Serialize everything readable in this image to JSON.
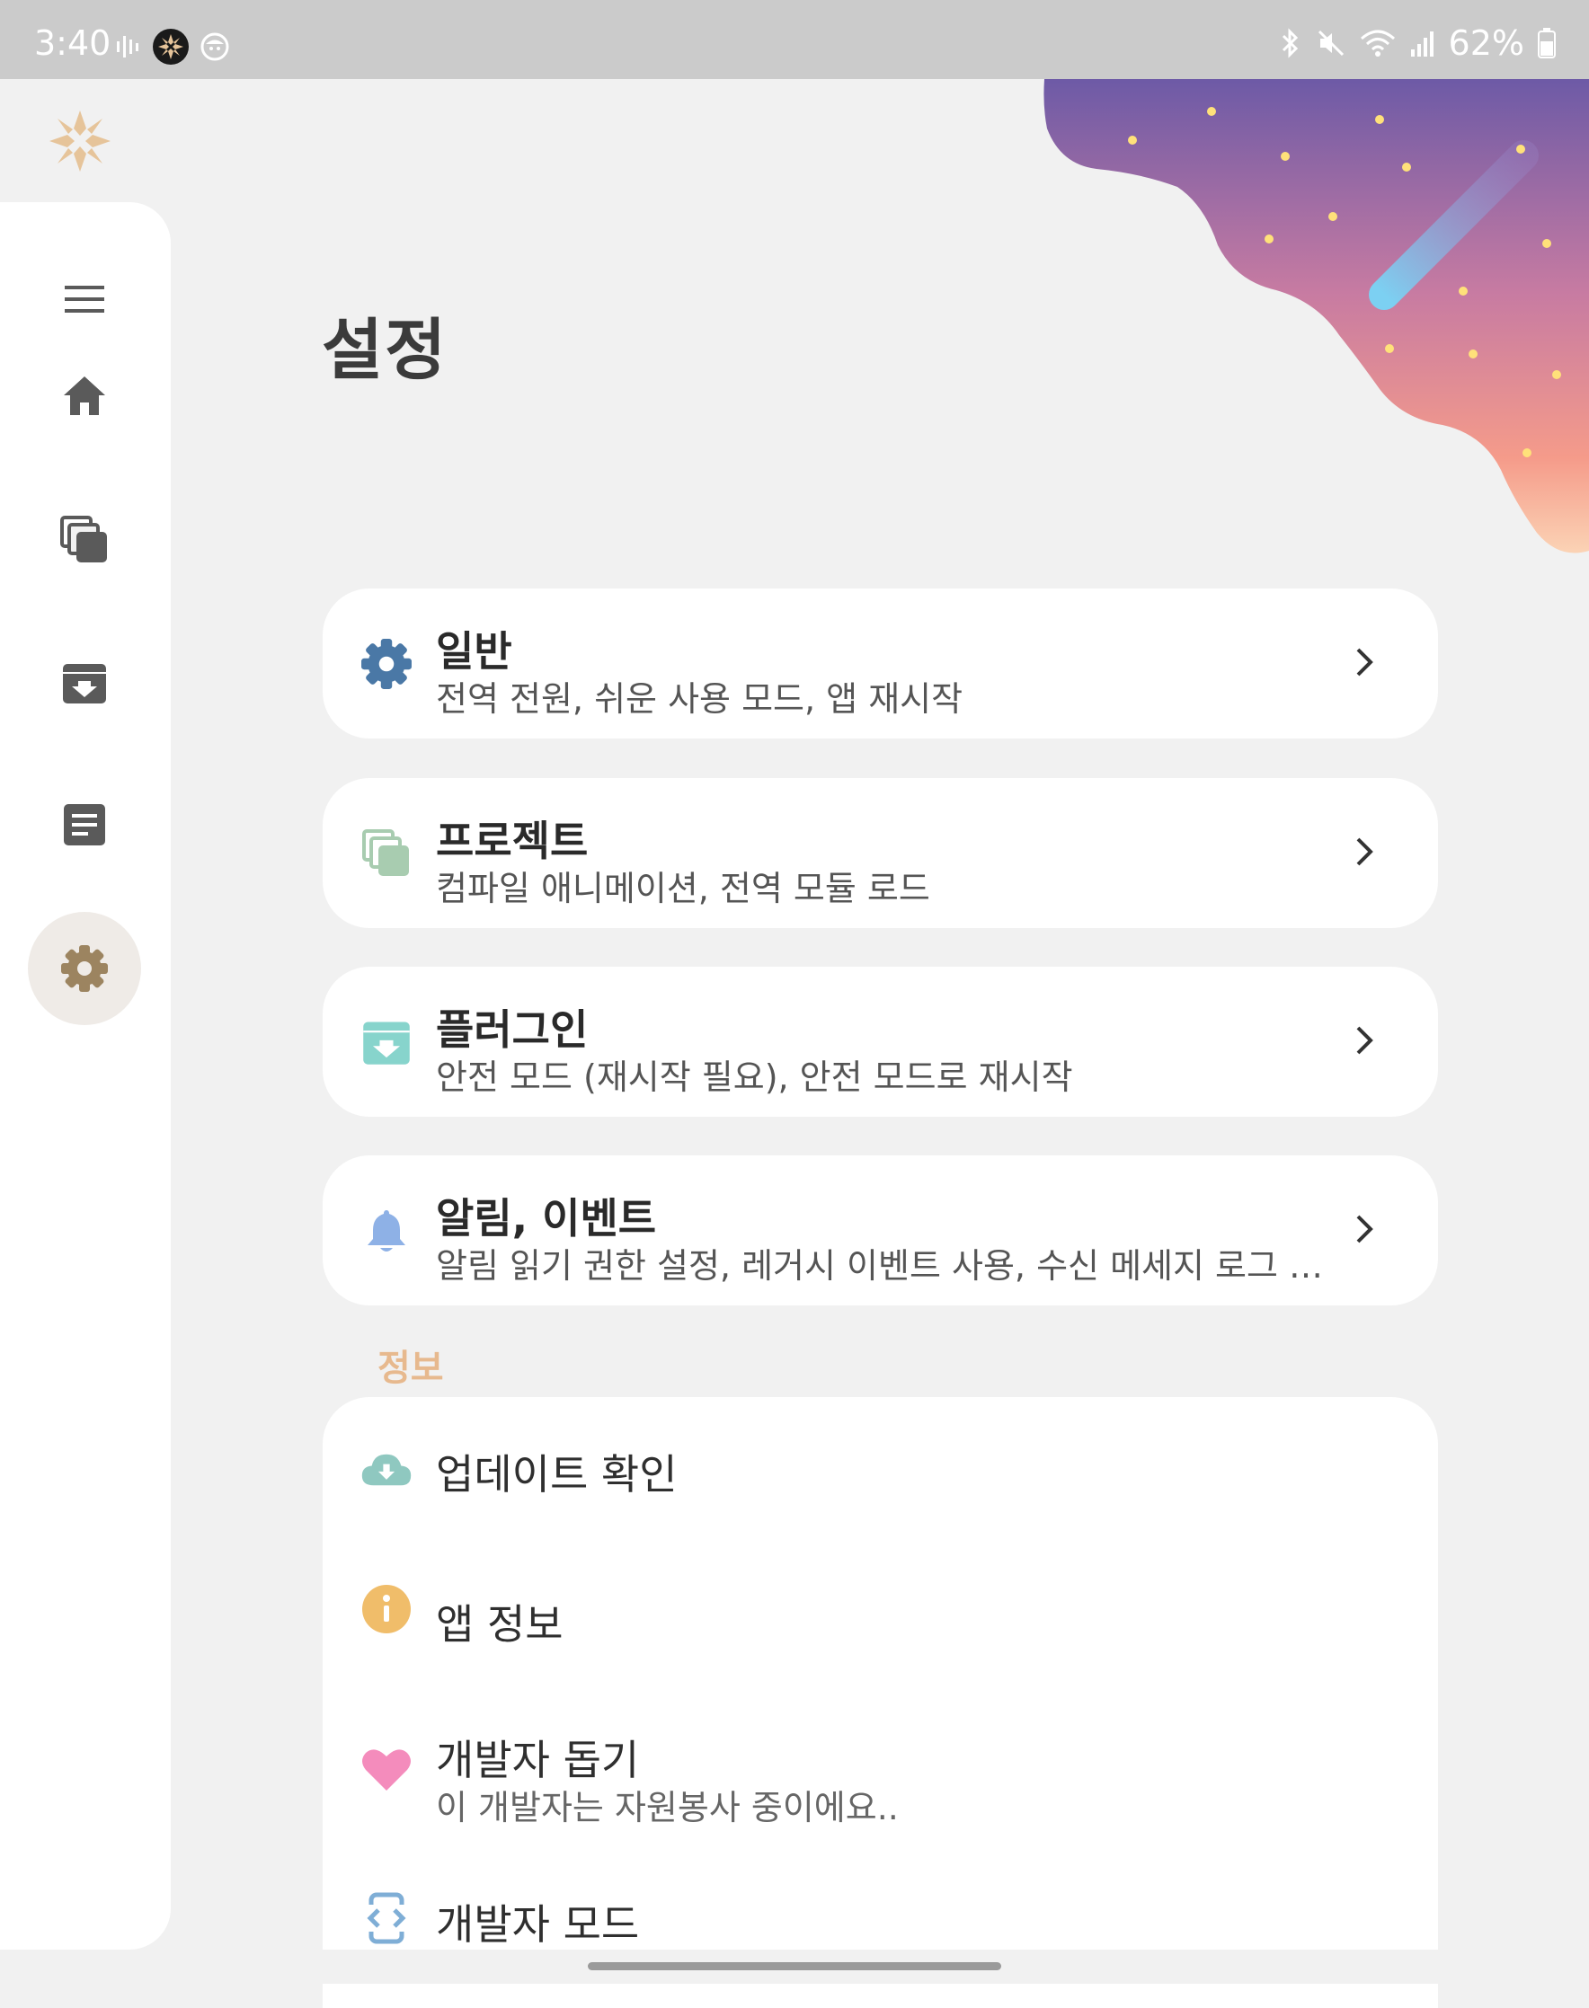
{
  "status_bar": {
    "time": "3:40",
    "battery_text": "62%",
    "icons": [
      "audio-bars-icon",
      "app-logo-icon",
      "face-icon",
      "bluetooth-icon",
      "mute-icon",
      "wifi-icon",
      "signal-icon",
      "battery-icon"
    ]
  },
  "nav_rail": {
    "items": [
      {
        "name": "menu",
        "icon": "menu-icon"
      },
      {
        "name": "home",
        "icon": "home-icon"
      },
      {
        "name": "projects",
        "icon": "copy-icon"
      },
      {
        "name": "plugins",
        "icon": "archive-icon"
      },
      {
        "name": "logs",
        "icon": "document-icon"
      },
      {
        "name": "settings",
        "icon": "gear-icon",
        "active": true
      }
    ]
  },
  "page": {
    "title": "설정"
  },
  "cards": [
    {
      "title": "일반",
      "subtitle": "전역 전원, 쉬운 사용 모드, 앱 재시작",
      "icon": "gear-icon",
      "color": "#4a78a6"
    },
    {
      "title": "프로젝트",
      "subtitle": "컴파일 애니메이션, 전역 모듈 로드",
      "icon": "copy-icon",
      "color": "#a8ccb0"
    },
    {
      "title": "플러그인",
      "subtitle": "안전 모드 (재시작 필요), 안전 모드로 재시작",
      "icon": "archive-icon",
      "color": "#87d4cc"
    },
    {
      "title": "알림, 이벤트",
      "subtitle": "알림 읽기 권한 설정, 레거시 이벤트 사용, 수신 메세지 로그 …",
      "icon": "bell-icon",
      "color": "#8eb1e6"
    }
  ],
  "info": {
    "section_label": "정보",
    "items": [
      {
        "title": "업데이트 확인",
        "subtitle": "",
        "icon": "cloud-download-icon",
        "color": "#8fc8c0"
      },
      {
        "title": "앱 정보",
        "subtitle": "",
        "icon": "info-icon",
        "color": "#f0bd6a"
      },
      {
        "title": "개발자 돕기",
        "subtitle": "이 개발자는 자원봉사 중이에요..",
        "icon": "heart-icon",
        "color": "#f48cbc"
      },
      {
        "title": "개발자 모드",
        "subtitle": "",
        "icon": "code-icon",
        "color": "#7faed6"
      }
    ]
  },
  "colors": {
    "rail_icon": "#5a5a5a",
    "active_icon": "#9c8460",
    "active_bg": "#efebe7",
    "section": "#e7b98e",
    "logo": "#e6c49a"
  }
}
